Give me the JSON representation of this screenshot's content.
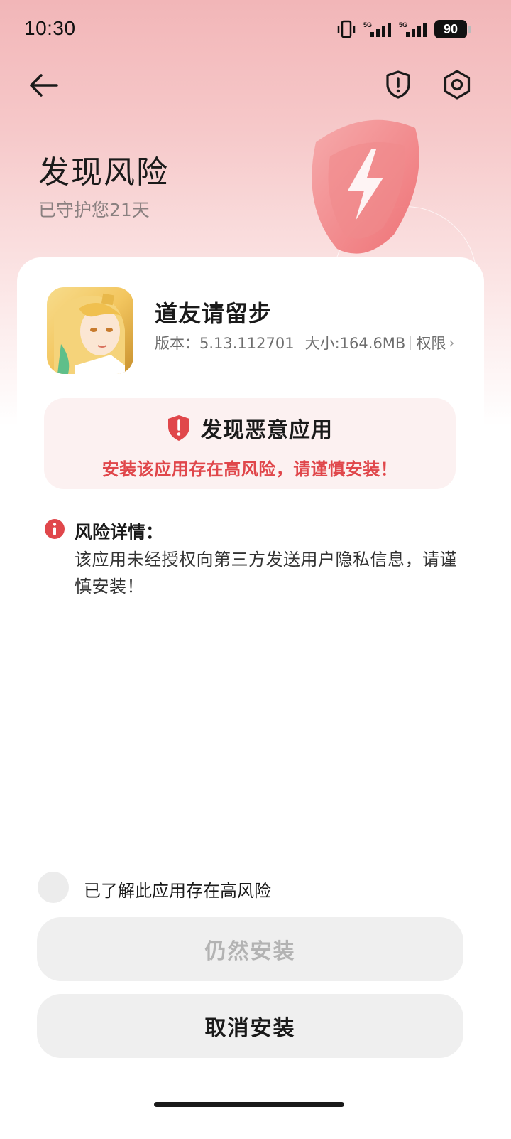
{
  "status_bar": {
    "time": "10:30",
    "battery": "90",
    "network_label": "5G"
  },
  "header": {
    "title": "发现风险",
    "subtitle": "已守护您21天"
  },
  "app": {
    "name": "道友请留步",
    "version": "版本：5.13.112701",
    "size": "大小:164.6MB",
    "permissions": "权限",
    "chevron": "›"
  },
  "alert": {
    "title": "发现恶意应用",
    "message": "安装该应用存在高风险，请谨慎安装！"
  },
  "risk": {
    "label": "风险详情：",
    "detail": "该应用未经授权向第三方发送用户隐私信息，请谨慎安装！"
  },
  "consent": {
    "label": "已了解此应用存在高风险",
    "checked": false
  },
  "buttons": {
    "install_anyway": "仍然安装",
    "cancel_install": "取消安装"
  },
  "colors": {
    "danger": "#e0474b",
    "header_gradient_top": "#f2b6b8",
    "button_bg": "#efefef"
  }
}
